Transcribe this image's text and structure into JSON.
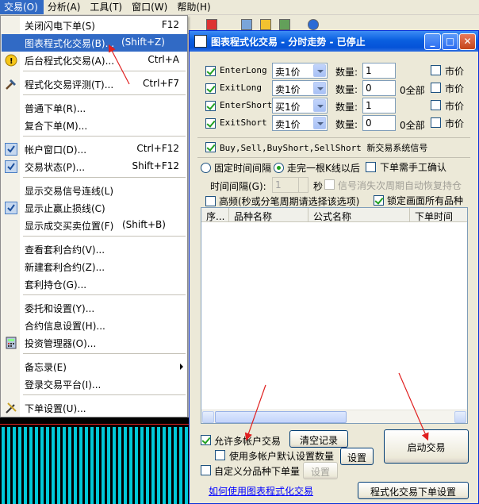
{
  "menubar": {
    "items": [
      "交易(O)",
      "分析(A)",
      "工具(T)",
      "窗口(W)",
      "帮助(H)"
    ]
  },
  "menu": {
    "items": [
      {
        "label": "关闭闪电下单(S)",
        "accel": "F12"
      },
      {
        "label": "图表程式化交易(B)...",
        "accel": "(Shift+Z)"
      },
      {
        "label": "后台程式化交易(A)...",
        "accel": "Ctrl+A"
      },
      {
        "label": "程式化交易评测(T)...",
        "accel": "Ctrl+F7"
      },
      {
        "label": "普通下单(R)..."
      },
      {
        "label": "复合下单(M)..."
      },
      {
        "label": "帐户窗口(D)...",
        "accel": "Ctrl+F12"
      },
      {
        "label": "交易状态(P)...",
        "accel": "Shift+F12"
      },
      {
        "label": "显示交易信号连线(L)"
      },
      {
        "label": "显示止赢止损线(C)"
      },
      {
        "label": "显示成交买卖位置(F)",
        "accel": "(Shift+B)"
      },
      {
        "label": "查看套利合约(V)..."
      },
      {
        "label": "新建套利合约(Z)..."
      },
      {
        "label": "套利持仓(G)..."
      },
      {
        "label": "委托和设置(Y)..."
      },
      {
        "label": "合约信息设置(H)..."
      },
      {
        "label": "投资管理器(O)..."
      },
      {
        "label": "备忘录(E)"
      },
      {
        "label": "登录交易平台(I)..."
      },
      {
        "label": "下单设置(U)..."
      }
    ]
  },
  "dialog": {
    "title": "图表程式化交易 - 分时走势 - 已停止",
    "signals": [
      {
        "name": "EnterLong",
        "price": "卖1价",
        "qty": "1",
        "all": ""
      },
      {
        "name": "ExitLong",
        "price": "卖1价",
        "qty": "0",
        "all": "0全部"
      },
      {
        "name": "EnterShort",
        "price": "买1价",
        "qty": "1",
        "all": ""
      },
      {
        "name": "ExitShort",
        "price": "卖1价",
        "qty": "0",
        "all": "0全部"
      }
    ],
    "qty_label": "数量:",
    "market_label": "市价",
    "new_signal_label": "Buy,Sell,BuyShort,SellShort 新交易系统信号",
    "fixed_interval_label": "固定时间间隔",
    "after_bar_label": "走完一根K线以后",
    "manual_confirm_label": "下单需手工确认",
    "interval_label": "时间间隔(G):",
    "interval_value": "1",
    "seconds_label": "秒",
    "auto_restore_label": "信号消失次周期自动恢复持仓",
    "hf_label": "高频(秒或分笔周期请选择该选项)",
    "lock_label": "锁定画面所有品种",
    "grid_headers": [
      "序...",
      "品种名称",
      "公式名称",
      "下单时间"
    ],
    "multi_account_label": "允许多帐户交易",
    "clear_label": "清空记录",
    "start_label": "启动交易",
    "use_default_qty_label": "使用多帐户默认设置数量",
    "settings_label": "设置",
    "custom_qty_label": "自定义分品种下单量",
    "settings2_label": "设置",
    "help_link": "如何使用图表程式化交易",
    "order_settings_label": "程式化交易下单设置"
  }
}
